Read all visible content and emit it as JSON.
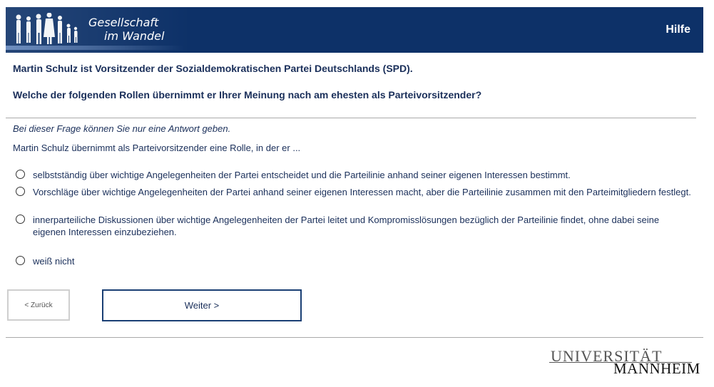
{
  "header": {
    "brand_line1": "Gesellschaft",
    "brand_line2": "im Wandel",
    "help_label": "Hilfe",
    "background": "#0d3168"
  },
  "question": {
    "intro": "Martin Schulz ist Vorsitzender der Sozialdemokratischen Partei Deutschlands (SPD).",
    "text": "Welche der folgenden Rollen übernimmt er Ihrer Meinung nach am ehesten als Parteivorsitzender?",
    "hint": "Bei dieser Frage können Sie nur eine Antwort geben.",
    "stem": "Martin Schulz übernimmt als Parteivorsitzender eine Rolle, in der er ..."
  },
  "options": [
    {
      "label": "selbstständig über wichtige Angelegenheiten der Partei entscheidet und die Parteilinie anhand seiner eigenen Interessen bestimmt.",
      "selected": false
    },
    {
      "label": "Vorschläge über wichtige Angelegenheiten der Partei anhand seiner eigenen Interessen macht, aber die Parteilinie zusammen mit den Parteimitgliedern festlegt.",
      "selected": false
    },
    {
      "label": "innerparteiliche Diskussionen über wichtige Angelegenheiten der Partei leitet und Kompromisslösungen bezüglich der Parteilinie findet, ohne dabei seine eigenen Interessen einzubeziehen.",
      "selected": false
    },
    {
      "label": "weiß nicht",
      "selected": false
    }
  ],
  "nav": {
    "back_label": "< Zurück",
    "next_label": "Weiter >"
  },
  "footer_logo": {
    "line1": "UNIVERSITÄT",
    "line2": "MANNHEIM"
  }
}
